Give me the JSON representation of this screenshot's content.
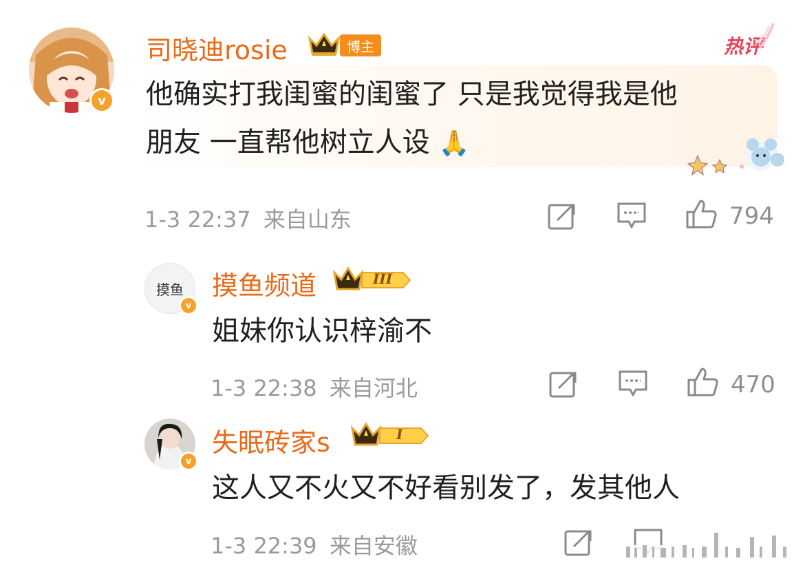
{
  "comments": [
    {
      "username": "司晓迪rosie",
      "badge": "博主",
      "hot_label": "热评",
      "text_line1": "他确实打我闺蜜的闺蜜了 只是我觉得我是他",
      "text_line2": "朋友 一直帮他树立人设",
      "emoji": "🙏",
      "timestamp": "1-3 22:37",
      "location": "来自山东",
      "likes": "794",
      "verified_mark": "v"
    },
    {
      "username": "摸鱼频道",
      "level": "III",
      "avatar_text": "摸鱼",
      "text": "姐妹你认识梓渝不",
      "timestamp": "1-3 22:38",
      "location": "来自河北",
      "likes": "470",
      "verified_mark": "v"
    },
    {
      "username": "失眠砖家s",
      "level": "I",
      "text": "这人又不火又不好看别发了，发其他人",
      "timestamp": "1-3 22:39",
      "location": "来自安徽",
      "verified_mark": "v"
    }
  ],
  "colors": {
    "username": "#e86b1a",
    "verified": "#f7a12b",
    "meta": "#9a9a9a",
    "hot": "#e8435a"
  }
}
